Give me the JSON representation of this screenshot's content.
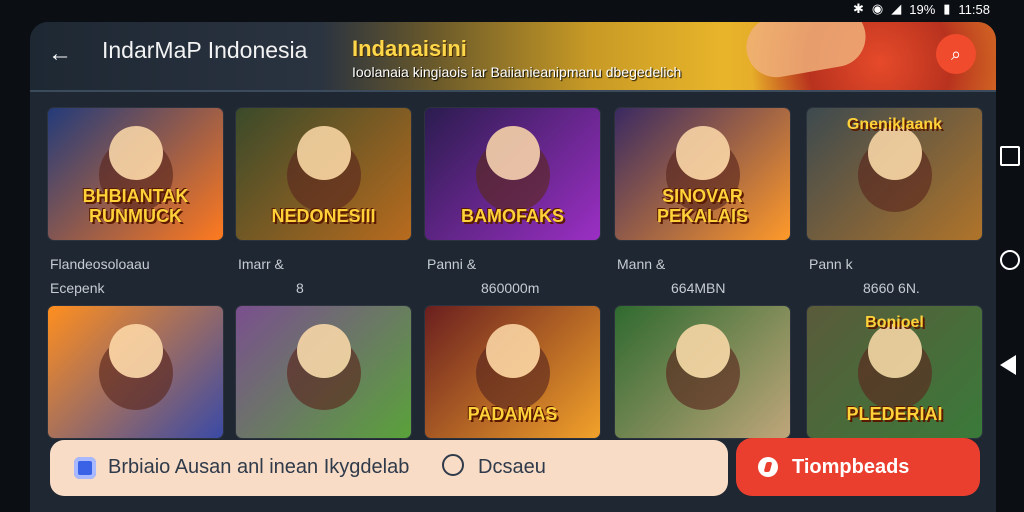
{
  "statusbar": {
    "battery": "19%",
    "time": "11:58"
  },
  "header": {
    "title": "IndarMaP Indonesia",
    "banner_title": "Indanaisini",
    "banner_subtitle": "Ioolanaia kingiaois iar Baiianieanipmanu dbegedelich"
  },
  "tiles": [
    {
      "top": "",
      "logo": "BHBIANTAK RUNMUCK",
      "c1": "#233b7a",
      "c2": "#ff7a1f"
    },
    {
      "top": "",
      "logo": "NEDONESIII",
      "c1": "#3a4a2a",
      "c2": "#b86b1e"
    },
    {
      "top": "",
      "logo": "BAMOFAKS",
      "c1": "#2b1c4f",
      "c2": "#9b2fc4"
    },
    {
      "top": "",
      "logo": "SINOVAR PEKALAIS",
      "c1": "#3a2a62",
      "c2": "#ff9a2a"
    },
    {
      "top": "Gneniklaank",
      "logo": "",
      "c1": "#3d4a4f",
      "c2": "#b0742a"
    },
    {
      "top": "",
      "logo": "",
      "c1": "#ff8f1f",
      "c2": "#3a4aa6"
    },
    {
      "top": "",
      "logo": "",
      "c1": "#7a4f8f",
      "c2": "#5aa23a"
    },
    {
      "top": "",
      "logo": "PADAMAS",
      "c1": "#6a1f1f",
      "c2": "#f2a22a"
    },
    {
      "top": "",
      "logo": "",
      "c1": "#2f6a2f",
      "c2": "#bfa67a"
    },
    {
      "top": "Bonioel",
      "logo": "PLEDERIAI",
      "c1": "#5a5a3a",
      "c2": "#3a7a3a"
    }
  ],
  "captions": {
    "c1_line1": "Flandeosoloaau",
    "c1_line2": "Ecepenk",
    "c2_line1": "Imarr &",
    "c2_line2": "8",
    "c3_line1": "Panni &",
    "c3_line2": "860000m",
    "c4_line1": "Mann &",
    "c4_line2": "664MBN",
    "c5_line1": "Pann k",
    "c5_line2": "8660 6N."
  },
  "bottom_bar": {
    "left_text": "Brbiaio Ausan anl inean Ikygdelab",
    "chat_label": "Dcsaeu",
    "cta_label": "Tiompbeads"
  }
}
